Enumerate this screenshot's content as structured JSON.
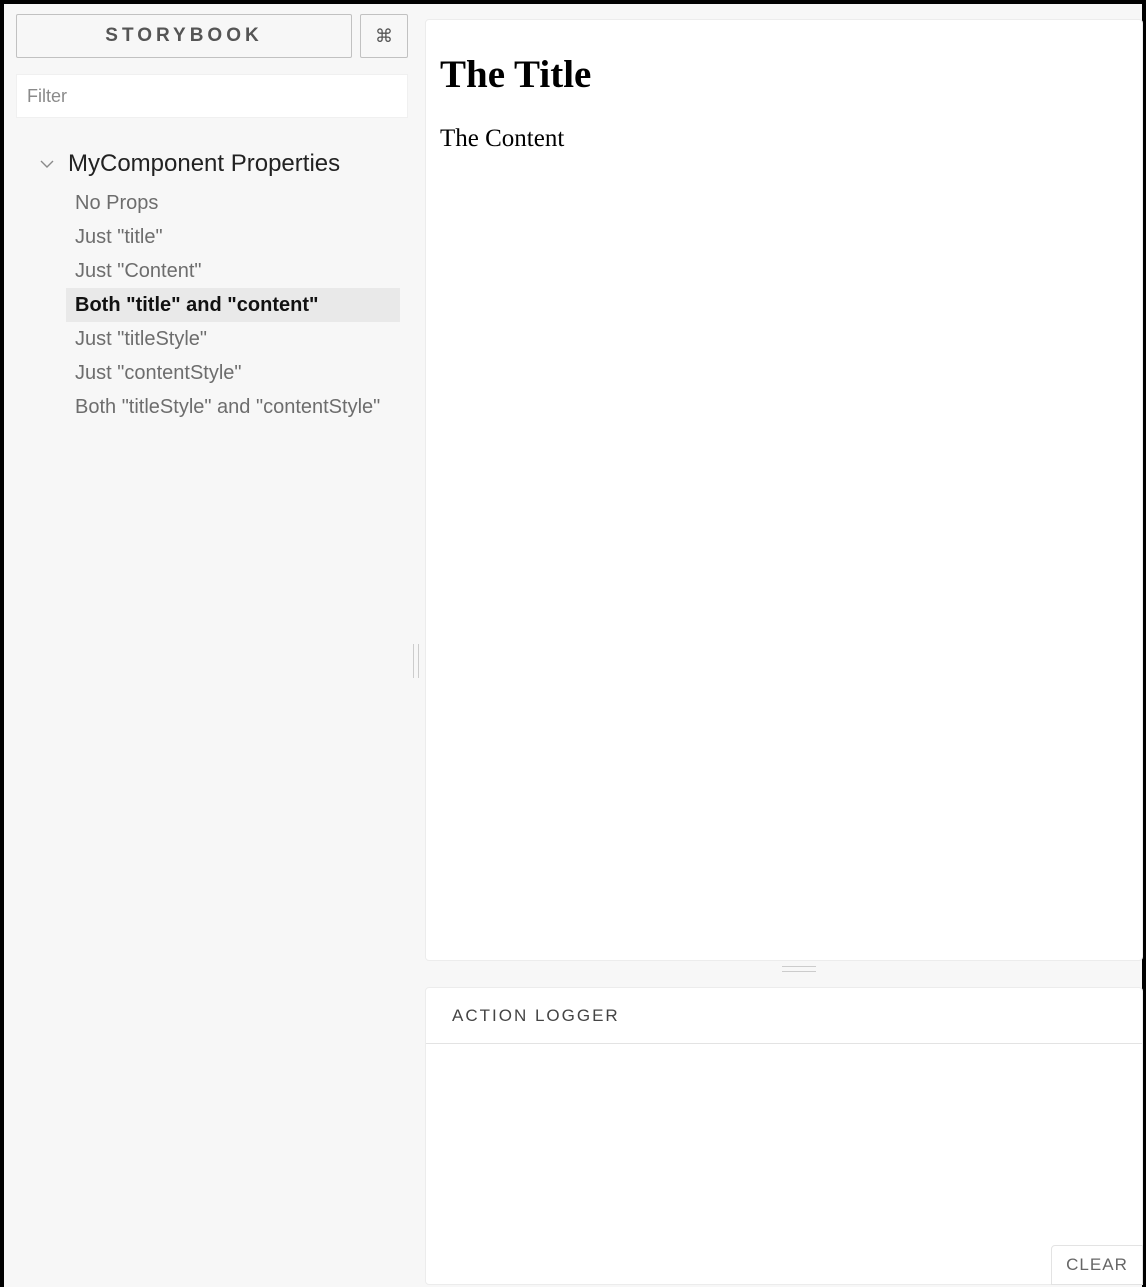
{
  "sidebar": {
    "brand_label": "STORYBOOK",
    "shortcut_icon": "command-key-icon",
    "shortcut_glyph": "⌘",
    "filter_placeholder": "Filter",
    "filter_value": "",
    "kind": {
      "label": "MyComponent Properties",
      "expanded": true,
      "icon": "chevron-down-icon"
    },
    "stories": [
      {
        "label": "No Props"
      },
      {
        "label": "Just \"title\""
      },
      {
        "label": "Just \"Content\""
      },
      {
        "label": "Both \"title\" and \"content\""
      },
      {
        "label": "Just \"titleStyle\""
      },
      {
        "label": "Just \"contentStyle\""
      },
      {
        "label": "Both \"titleStyle\" and \"contentStyle\""
      }
    ],
    "selected_story": "Both \"title\" and \"content\""
  },
  "preview": {
    "title": "The Title",
    "content": "The Content"
  },
  "action_logger": {
    "tab_label": "ACTION LOGGER",
    "clear_label": "CLEAR"
  },
  "colors": {
    "sidebar_bg": "#f7f7f7",
    "selected_bg": "#e9e9e9",
    "story_text": "#6d6d6d"
  }
}
